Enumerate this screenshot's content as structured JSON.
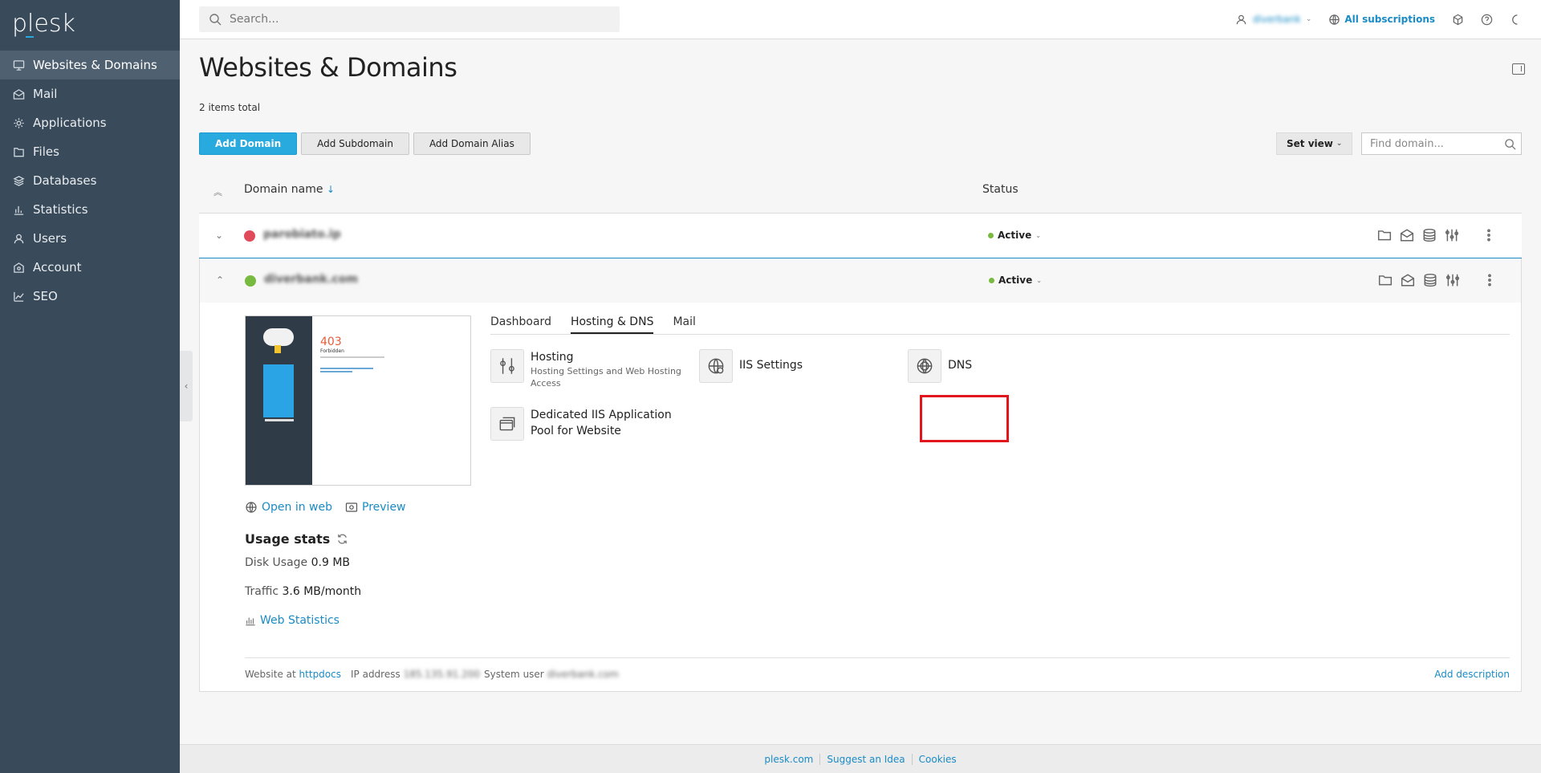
{
  "app": {
    "logo": "plesk"
  },
  "sidebar": {
    "items": [
      {
        "label": "Websites & Domains",
        "icon": "monitor-icon",
        "active": true
      },
      {
        "label": "Mail",
        "icon": "mail-icon"
      },
      {
        "label": "Applications",
        "icon": "gear-icon"
      },
      {
        "label": "Files",
        "icon": "files-icon"
      },
      {
        "label": "Databases",
        "icon": "database-icon"
      },
      {
        "label": "Statistics",
        "icon": "bar-chart-icon"
      },
      {
        "label": "Users",
        "icon": "user-icon"
      },
      {
        "label": "Account",
        "icon": "account-icon"
      },
      {
        "label": "SEO",
        "icon": "seo-icon"
      }
    ]
  },
  "topbar": {
    "search_placeholder": "Search...",
    "user": "diverbank",
    "subscriptions": "All subscriptions"
  },
  "page": {
    "title": "Websites & Domains",
    "items_total": "2 items total",
    "buttons": {
      "add_domain": "Add Domain",
      "add_subdomain": "Add Subdomain",
      "add_alias": "Add Domain Alias"
    },
    "set_view": "Set view",
    "find_placeholder": "Find domain..."
  },
  "table": {
    "col_domain": "Domain name",
    "col_status": "Status",
    "rows": [
      {
        "name": "parobiato.ip",
        "status": "Active",
        "favicon_color": "#e04a5a"
      },
      {
        "name": "diverbank.com",
        "status": "Active",
        "favicon_color": "#78b93f"
      }
    ]
  },
  "expanded": {
    "thumb": {
      "code": "403",
      "text": "Forbidden"
    },
    "open_in_web": "Open in web",
    "preview": "Preview",
    "usage_title": "Usage stats",
    "disk_label": "Disk Usage",
    "disk_value": "0.9 MB",
    "traffic_label": "Traffic",
    "traffic_value": "3.6 MB/month",
    "web_statistics": "Web Statistics",
    "tabs": [
      "Dashboard",
      "Hosting & DNS",
      "Mail"
    ],
    "active_tab": "Hosting & DNS",
    "tools": {
      "hosting_title": "Hosting",
      "hosting_sub": "Hosting Settings and Web Hosting Access",
      "iis_title": "IIS Settings",
      "dns_title": "DNS",
      "pool_title": "Dedicated IIS Application Pool for Website"
    },
    "footer": {
      "website_at_label": "Website at",
      "website_at_value": "httpdocs",
      "ip_label": "IP address",
      "ip_value": "185.135.91.200",
      "sysuser_label": "System user",
      "sysuser_value": "diverbank.com",
      "add_description": "Add description"
    }
  },
  "footer": {
    "links": [
      "plesk.com",
      "Suggest an Idea",
      "Cookies"
    ]
  },
  "colors": {
    "sidebar": "#394a5a",
    "accent": "#28aade",
    "link": "#1a8bc5",
    "highlight": "#e2141c",
    "status_active": "#78b93f"
  }
}
